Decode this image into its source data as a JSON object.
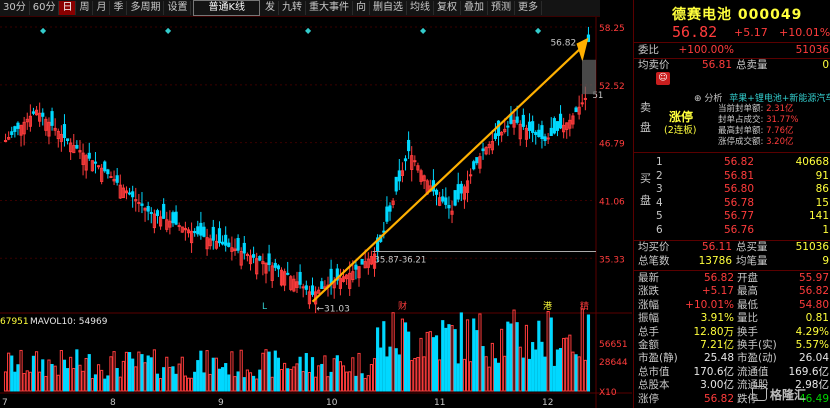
{
  "toolbar": {
    "items": [
      "30分",
      "60分",
      "日",
      "周",
      "月",
      "季",
      "多周期",
      "设置",
      "普通K线",
      "发",
      "九转",
      "重大事件",
      "向",
      "删自选",
      "均线",
      "复权",
      "叠加",
      "预测",
      "更多"
    ],
    "active_index": 2
  },
  "stock": {
    "name": "德赛电池",
    "code": "000049",
    "price": "56.82",
    "change": "+5.17",
    "pct": "+10.01%"
  },
  "quote": {
    "weibi_label": "委比",
    "weibi": "+100.00%",
    "weibi_vol": "51036",
    "avg_sell_label": "均卖价",
    "avg_sell": "56.81",
    "total_sell_label": "总卖量",
    "total_sell": "0",
    "sell_side": "卖盘",
    "buy_side": "买盘",
    "avg_buy_label": "均买价",
    "avg_buy": "56.11",
    "total_buy_label": "总买量",
    "total_buy": "51036",
    "trades_label": "总笔数",
    "trades": "13786",
    "avg_trade_label": "均笔量",
    "avg_trade": "9"
  },
  "limit_up": {
    "analysis_label": "分析",
    "concepts": "苹果+锂电池+新能源汽车",
    "status": "涨停",
    "streak": "(2连板)",
    "lines": [
      {
        "label": "当前封单额:",
        "value": "2.31亿"
      },
      {
        "label": "封单占成交:",
        "value": "31.77%"
      },
      {
        "label": "最高封单额:",
        "value": "7.76亿"
      },
      {
        "label": "涨停成交额:",
        "value": "3.20亿"
      }
    ]
  },
  "buy_levels": [
    {
      "n": "1",
      "price": "56.82",
      "vol": "40668"
    },
    {
      "n": "2",
      "price": "56.81",
      "vol": "91"
    },
    {
      "n": "3",
      "price": "56.80",
      "vol": "86"
    },
    {
      "n": "4",
      "price": "56.78",
      "vol": "15"
    },
    {
      "n": "5",
      "price": "56.77",
      "vol": "141"
    },
    {
      "n": "6",
      "price": "56.76",
      "vol": "1"
    }
  ],
  "stats": [
    {
      "l1": "最新",
      "v1": "56.82",
      "c1": "red",
      "l2": "开盘",
      "v2": "55.97",
      "c2": "red"
    },
    {
      "l1": "涨跌",
      "v1": "+5.17",
      "c1": "red",
      "l2": "最高",
      "v2": "56.82",
      "c2": "red"
    },
    {
      "l1": "涨幅",
      "v1": "+10.01%",
      "c1": "red",
      "l2": "最低",
      "v2": "54.80",
      "c2": "red"
    },
    {
      "l1": "振幅",
      "v1": "3.91%",
      "c1": "yel",
      "l2": "量比",
      "v2": "0.81",
      "c2": "yel"
    },
    {
      "l1": "总手",
      "v1": "12.80万",
      "c1": "yel",
      "l2": "换手",
      "v2": "4.29%",
      "c2": "yel"
    },
    {
      "l1": "金额",
      "v1": "7.21亿",
      "c1": "yel",
      "l2": "换手(实)",
      "v2": "5.57%",
      "c2": "yel"
    },
    {
      "l1": "市盈(静)",
      "v1": "25.48",
      "c1": "wht",
      "l2": "市盈(动)",
      "v2": "26.04",
      "c2": "wht"
    },
    {
      "l1": "总市值",
      "v1": "170.6亿",
      "c1": "wht",
      "l2": "流通值",
      "v2": "169.6亿",
      "c2": "wht"
    },
    {
      "l1": "总股本",
      "v1": "3.00亿",
      "c1": "wht",
      "l2": "流通股",
      "v2": "2.98亿",
      "c2": "wht"
    },
    {
      "l1": "涨停",
      "v1": "56.82",
      "c1": "red",
      "l2": "跌停",
      "v2": "46.49",
      "c2": "grn"
    }
  ],
  "chart_labels": {
    "price_ticks": [
      "58.25",
      "52.52",
      "46.79",
      "41.06",
      "35.33"
    ],
    "volume_ticks": [
      "56651",
      "28644",
      "X10"
    ],
    "months": [
      "7",
      "8",
      "9",
      "10",
      "11",
      "12"
    ],
    "ma_text": "MAVOL10: 54969",
    "ma_left": "67951",
    "high_label": "56.82",
    "low_label": "31.03",
    "range_label": "35.87-36.21",
    "last_label": "51",
    "markers": [
      "L",
      "财",
      "港",
      "精"
    ]
  },
  "watermark": "格隆汇"
}
